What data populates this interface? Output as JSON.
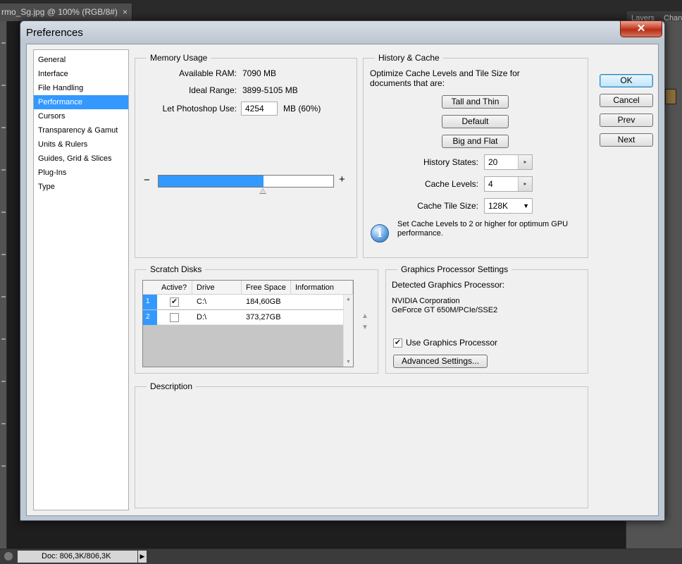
{
  "photoshop": {
    "document_tab": "rmo_Sg.jpg @ 100% (RGB/8#)",
    "document_tab_close": "×",
    "panel_tabs": [
      "Layers",
      "Chan"
    ],
    "status_doc_info": "Doc: 806,3K/806,3K",
    "status_arrow": "▶"
  },
  "dialog": {
    "title": "Preferences",
    "close_label": "✕",
    "buttons": {
      "ok": "OK",
      "cancel": "Cancel",
      "prev": "Prev",
      "next": "Next"
    }
  },
  "categories": [
    {
      "label": "General",
      "selected": false
    },
    {
      "label": "Interface",
      "selected": false
    },
    {
      "label": "File Handling",
      "selected": false
    },
    {
      "label": "Performance",
      "selected": true
    },
    {
      "label": "Cursors",
      "selected": false
    },
    {
      "label": "Transparency & Gamut",
      "selected": false
    },
    {
      "label": "Units & Rulers",
      "selected": false
    },
    {
      "label": "Guides, Grid & Slices",
      "selected": false
    },
    {
      "label": "Plug-Ins",
      "selected": false
    },
    {
      "label": "Type",
      "selected": false
    }
  ],
  "memory_usage": {
    "title": "Memory Usage",
    "available_ram_label": "Available RAM:",
    "available_ram_value": "7090 MB",
    "ideal_range_label": "Ideal Range:",
    "ideal_range_value": "3899-5105 MB",
    "let_use_label": "Let Photoshop Use:",
    "let_use_value": "4254",
    "let_use_suffix": "MB (60%)",
    "slider_minus": "−",
    "slider_plus": "+",
    "slider_fraction": 0.6
  },
  "history_cache": {
    "title": "History & Cache",
    "description": "Optimize Cache Levels and Tile Size for documents that are:",
    "btn_tall_thin": "Tall and Thin",
    "btn_default": "Default",
    "btn_big_flat": "Big and Flat",
    "history_states_label": "History States:",
    "history_states_value": "20",
    "cache_levels_label": "Cache Levels:",
    "cache_levels_value": "4",
    "cache_tile_size_label": "Cache Tile Size:",
    "cache_tile_size_value": "128K",
    "info_icon_glyph": "i",
    "info_text": "Set Cache Levels to 2 or higher for optimum GPU performance."
  },
  "scratch_disks": {
    "title": "Scratch Disks",
    "columns": [
      "Active?",
      "Drive",
      "Free Space",
      "Information"
    ],
    "rows": [
      {
        "num": "1",
        "active": true,
        "check_glyph": "✔",
        "drive": "C:\\",
        "free_space": "184,60GB",
        "information": ""
      },
      {
        "num": "2",
        "active": false,
        "check_glyph": "",
        "drive": "D:\\",
        "free_space": "373,27GB",
        "information": ""
      }
    ],
    "move_up": "▲",
    "move_down": "▼"
  },
  "gpu": {
    "title": "Graphics Processor Settings",
    "detected_label": "Detected Graphics Processor:",
    "vendor": "NVIDIA Corporation",
    "model": "GeForce GT 650M/PCIe/SSE2",
    "use_gpu_label": "Use Graphics Processor",
    "use_gpu_checked": true,
    "use_gpu_check_glyph": "✔",
    "advanced_button": "Advanced Settings..."
  },
  "description": {
    "title": "Description",
    "text": ""
  },
  "icons": {
    "spin_up": "▸",
    "dropdown": "▼",
    "scroll_up": "▲",
    "scroll_down": "▼"
  },
  "colors": {
    "selection": "#3399ff",
    "close_button": "#c8452f"
  }
}
